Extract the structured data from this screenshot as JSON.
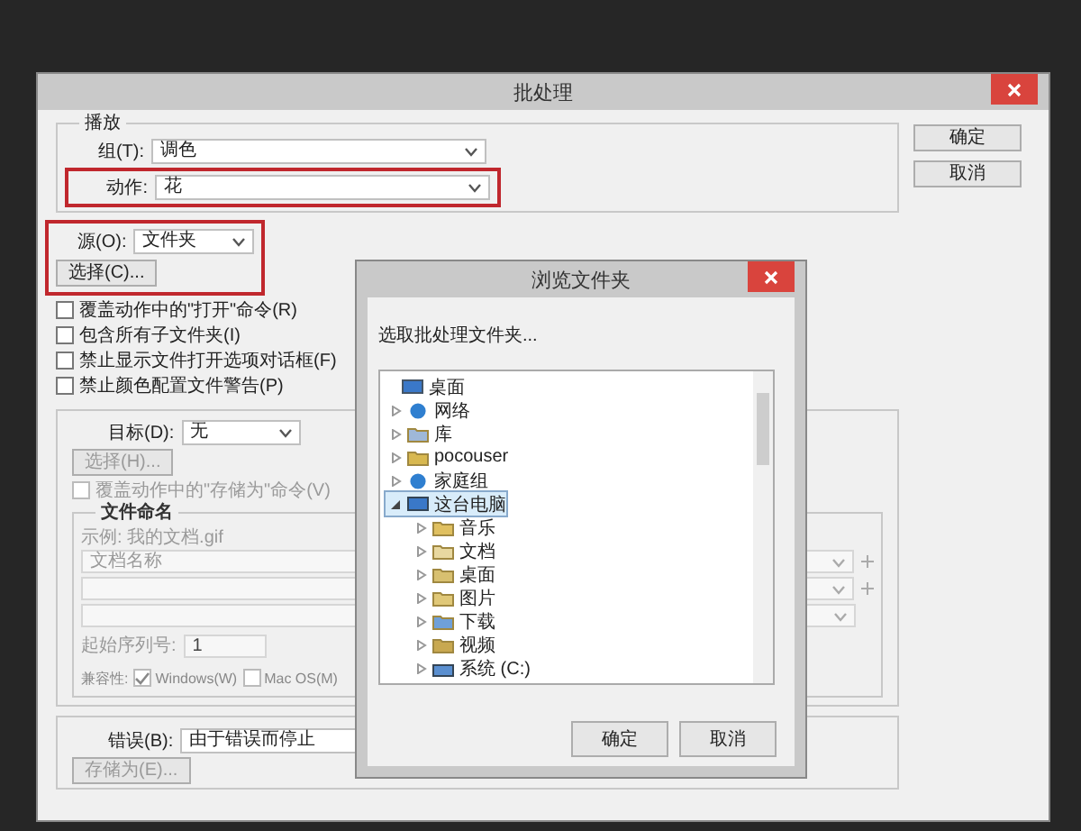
{
  "batch_dialog": {
    "title": "批处理",
    "buttons": [
      "确定",
      "取消"
    ],
    "play": {
      "legend": "播放",
      "group": {
        "label": "组(T):",
        "value": "调色"
      },
      "action": {
        "label": "动作:",
        "value": "花",
        "highlighted": true
      }
    },
    "source": {
      "label": "源(O):",
      "value": "文件夹",
      "highlighted": true,
      "choose_button": "选择(C)...",
      "options": [
        {
          "label": "覆盖动作中的\"打开\"命令(R)",
          "checked": false
        },
        {
          "label": "包含所有子文件夹(I)",
          "checked": false
        },
        {
          "label": "禁止显示文件打开选项对话框(F)",
          "checked": false
        },
        {
          "label": "禁止颜色配置文件警告(P)",
          "checked": false
        }
      ]
    },
    "destination": {
      "label": "目标(D):",
      "value": "无",
      "choose_button": "选择(H)...",
      "disabled": true,
      "override": {
        "label": "覆盖动作中的\"存储为\"命令(V)",
        "checked": false
      },
      "file_naming": {
        "legend": "文件命名",
        "example": "示例: 我的文档.gif",
        "first_field": "文档名称",
        "serial": {
          "label": "起始序列号:",
          "value": "1"
        },
        "compatibility": {
          "label": "兼容性:",
          "options": [
            {
              "label": "Windows(W)",
              "checked": true
            },
            {
              "label": "Mac OS(M)",
              "checked": false
            }
          ]
        }
      }
    },
    "errors": {
      "label": "错误(B):",
      "value": "由于错误而停止",
      "save_button": "存储为(E)..."
    }
  },
  "browse_dialog": {
    "title": "浏览文件夹",
    "prompt": "选取批处理文件夹...",
    "tree": [
      {
        "label": "桌面",
        "kind": "desktop",
        "selected": false,
        "children": [
          {
            "label": "网络",
            "kind": "network",
            "expanded": false,
            "selected": false
          },
          {
            "label": "库",
            "kind": "library",
            "expanded": false,
            "selected": false
          },
          {
            "label": "pocouser",
            "kind": "user",
            "expanded": false,
            "selected": false
          },
          {
            "label": "家庭组",
            "kind": "homegroup",
            "expanded": false,
            "selected": false
          },
          {
            "label": "这台电脑",
            "kind": "computer",
            "expanded": true,
            "selected": true,
            "children": [
              {
                "label": "音乐",
                "kind": "music",
                "expanded": false,
                "selected": false
              },
              {
                "label": "文档",
                "kind": "documents",
                "expanded": false,
                "selected": false
              },
              {
                "label": "桌面",
                "kind": "desktop-folder",
                "expanded": false,
                "selected": false
              },
              {
                "label": "图片",
                "kind": "pictures",
                "expanded": false,
                "selected": false
              },
              {
                "label": "下载",
                "kind": "downloads",
                "expanded": false,
                "selected": false
              },
              {
                "label": "视频",
                "kind": "videos",
                "expanded": false,
                "selected": false
              },
              {
                "label": "系统 (C:)",
                "kind": "drive",
                "expanded": false,
                "selected": false
              }
            ]
          }
        ]
      }
    ],
    "buttons": [
      "确定",
      "取消"
    ]
  }
}
